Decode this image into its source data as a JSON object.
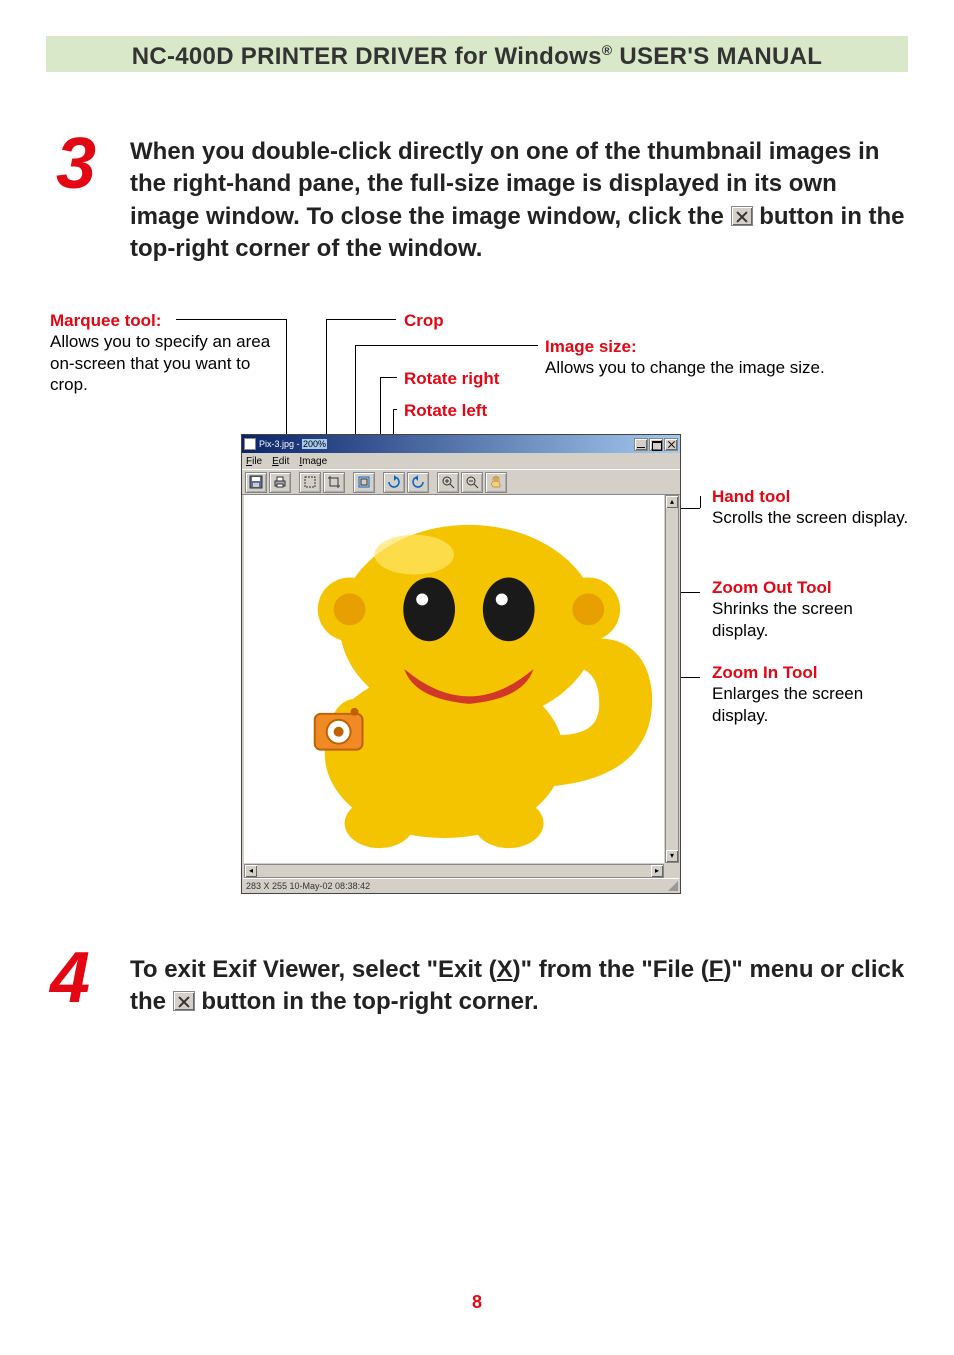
{
  "header": {
    "title_left": "NC-400D PRINTER DRIVER for Windows",
    "title_sup": "®",
    "title_right": " USER'S MANUAL"
  },
  "step3": {
    "number": "3",
    "text_a": "When you double-click directly on one of the thumbnail images in the right-hand pane, the full-size image is displayed in its own image window. To close the image window, click the ",
    "text_b": " button in the top-right corner of the window."
  },
  "callouts": {
    "marquee_title": "Marquee tool:",
    "marquee_body": "Allows you to specify an area on-screen that you want to crop.",
    "crop": "Crop",
    "imagesize_title": "Image size:",
    "imagesize_body": "Allows you to change the image size.",
    "rotate_right": "Rotate right",
    "rotate_left": "Rotate left",
    "hand_title": "Hand tool",
    "hand_body": "Scrolls the screen display.",
    "zoomout_title": "Zoom Out Tool",
    "zoomout_body": "Shrinks the screen display.",
    "zoomin_title": "Zoom In Tool",
    "zoomin_body": "Enlarges the screen display."
  },
  "window": {
    "title_prefix": "Pix-3.jpg - ",
    "zoom": "200%",
    "menu_file": "File",
    "menu_edit": "Edit",
    "menu_image": "Image",
    "status": "283 X 255   10-May-02 08:38:42"
  },
  "step4": {
    "number": "4",
    "text_a": "To exit Exif Viewer, select \"Exit (",
    "text_x": "X",
    "text_b": ")\" from the \"File (",
    "text_f": "F",
    "text_c": ")\" menu or click the ",
    "text_d": " button in the top-right corner."
  },
  "page_number": "8"
}
